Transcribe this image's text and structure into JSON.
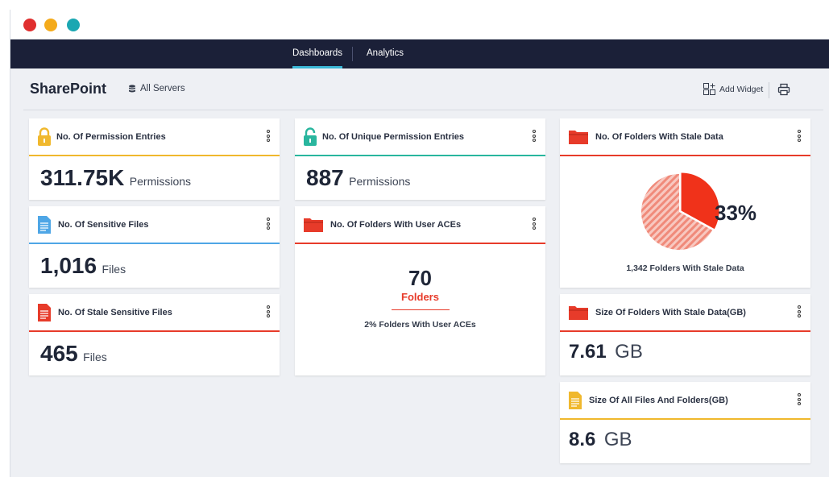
{
  "window_controls": {
    "close_color": "#e02f2f",
    "minimize_color": "#f4ab1c",
    "maximize_color": "#1ba7b2"
  },
  "nav": {
    "tabs": [
      "Dashboards",
      "Analytics"
    ],
    "active_tab": "Dashboards",
    "accent": "#3bb7d6"
  },
  "header": {
    "title": "SharePoint",
    "server_filter": "All Servers",
    "add_widget_label": "Add Widget"
  },
  "cards": {
    "permission_entries": {
      "title": "No. Of Permission Entries",
      "value": "311.75K",
      "unit": "Permissions",
      "accent": "#f0b82d",
      "icon": "lock-icon"
    },
    "sensitive_files": {
      "title": "No. Of Sensitive Files",
      "value": "1,016",
      "unit": "Files",
      "accent": "#4ea6e6",
      "icon": "document-icon"
    },
    "stale_sensitive_files": {
      "title": "No. Of Stale Sensitive Files",
      "value": "465",
      "unit": "Files",
      "accent": "#e73b2a",
      "icon": "document-icon"
    },
    "unique_permission_entries": {
      "title": "No. Of Unique Permission Entries",
      "value": "887",
      "unit": "Permissions",
      "accent": "#29b69e",
      "icon": "unlock-icon"
    },
    "folders_user_aces": {
      "title": "No. Of Folders With User ACEs",
      "value": "70",
      "unit": "Folders",
      "caption": "2% Folders With User ACEs",
      "accent": "#e73b2a",
      "icon": "folder-icon"
    },
    "folders_stale_data": {
      "title": "No. Of Folders With Stale Data",
      "percent_label": "33%",
      "stale_fraction": 0.33,
      "caption": "1,342 Folders With Stale Data",
      "accent": "#e73b2a",
      "icon": "folder-icon"
    },
    "size_stale_folders": {
      "title": "Size Of Folders With Stale Data(GB)",
      "value": "7.61",
      "unit": "GB",
      "accent": "#e73b2a",
      "icon": "folder-icon"
    },
    "size_all_files": {
      "title": "Size Of All Files And Folders(GB)",
      "value": "8.6",
      "unit": "GB",
      "accent": "#f0b82d",
      "icon": "document-icon"
    }
  }
}
